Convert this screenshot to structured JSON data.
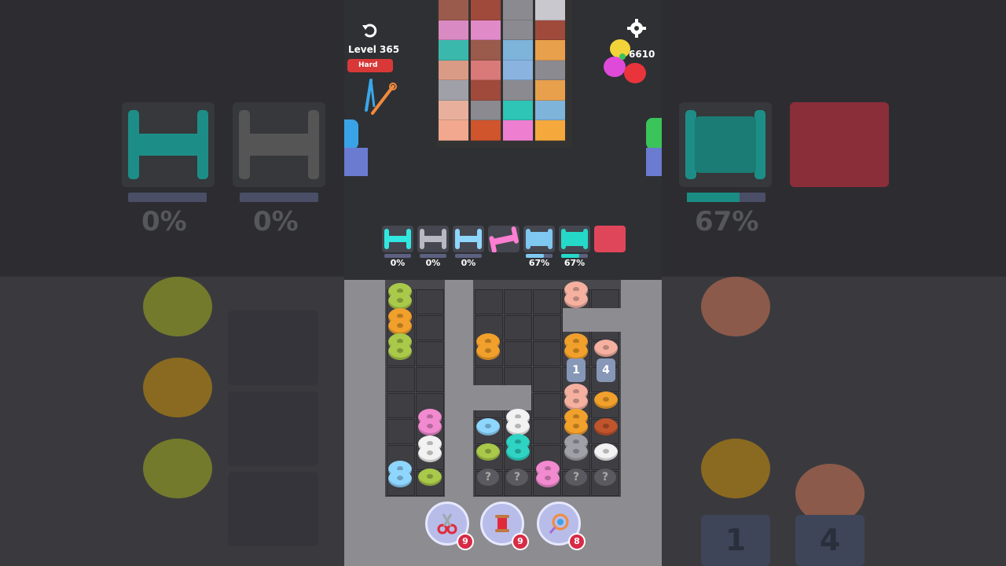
{
  "header": {
    "level_label": "Level 365",
    "difficulty_label": "Hard",
    "coins": "6610"
  },
  "icons": {
    "undo": "undo-icon",
    "settings": "gear-icon",
    "pins": "safety-pins-icon",
    "coins": "buttons-coin-icon"
  },
  "cloth": {
    "columns": [
      {
        "colors": [
          "#9a5a4c",
          "#d98ac2",
          "#3bb8ac",
          "#d99a86",
          "#a0a0a8",
          "#e8b09c",
          "#f2a88f"
        ]
      },
      {
        "colors": [
          "#a04a3c",
          "#e08ac8",
          "#9a5a4c",
          "#d97a78",
          "#a04a3c",
          "#8a8a90",
          "#d0542c"
        ]
      },
      {
        "colors": [
          "#8a8a90",
          "#8a8a90",
          "#7eb3da",
          "#8ab3e0",
          "#8a8a90",
          "#2ec4b6",
          "#ee7fd0"
        ]
      },
      {
        "colors": [
          "#c8c8ce",
          "#a04a3c",
          "#e8a04c",
          "#8a8a90",
          "#e8a04c",
          "#7eb3da",
          "#f5a93c"
        ]
      }
    ]
  },
  "spools": [
    {
      "color": "#31e8e0",
      "percent": "0%"
    },
    {
      "color": "#b8b8c0",
      "percent": "0%"
    },
    {
      "color": "#8fd6ff",
      "percent": "0%"
    },
    {
      "color": "#ff7ed2",
      "percent": ""
    },
    {
      "color": "#7ec8f2",
      "percent": "67%"
    },
    {
      "color": "#25d9c8",
      "percent": "67%"
    },
    {
      "color": "#e0465a",
      "percent": ""
    }
  ],
  "locked_slots": [
    {
      "number": "1"
    },
    {
      "number": "4"
    }
  ],
  "question_marks": [
    "?",
    "?",
    "?",
    "?"
  ],
  "boosters": [
    {
      "name": "scissors",
      "count": "9"
    },
    {
      "name": "thread-spool",
      "count": "9"
    },
    {
      "name": "magnet",
      "count": "8"
    }
  ],
  "side_percents": [
    "0%",
    "0%",
    "67%"
  ],
  "side_locked": [
    "1",
    "4"
  ]
}
